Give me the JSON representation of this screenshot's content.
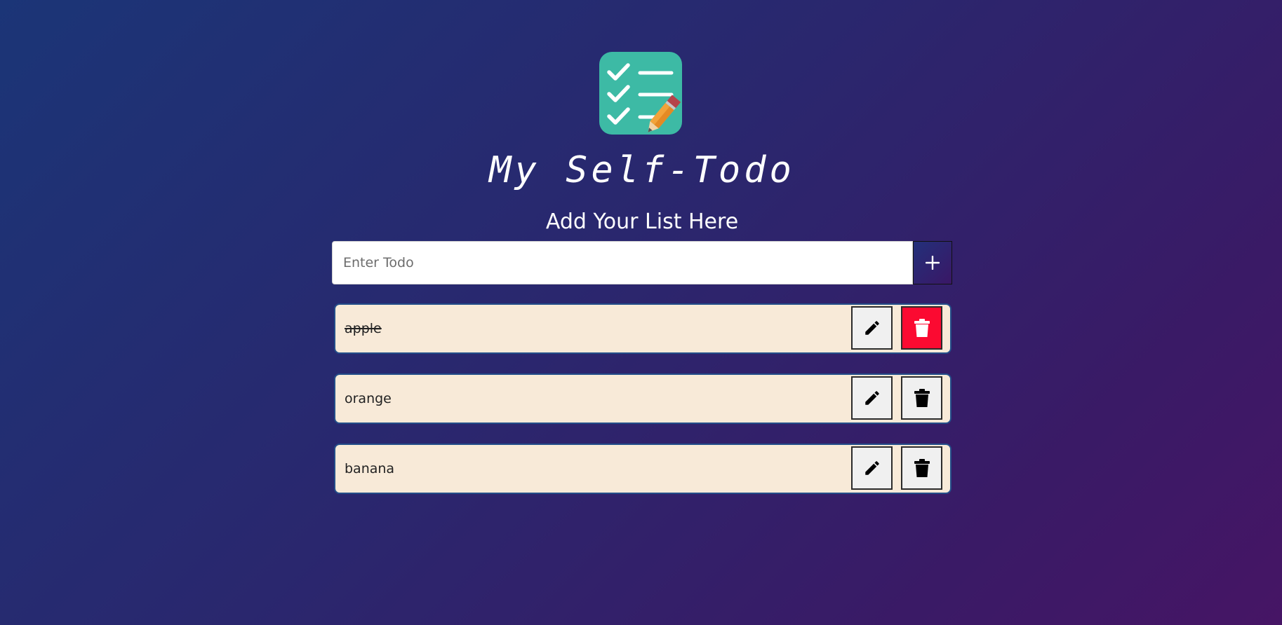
{
  "app": {
    "logo_icon": "checklist-pencil-icon",
    "title": "My Self-Todo",
    "subtitle": "Add Your List Here"
  },
  "input": {
    "placeholder": "Enter Todo",
    "value": "",
    "add_icon": "plus-icon"
  },
  "todos": [
    {
      "text": "apple",
      "completed": true,
      "edit_icon": "pencil-icon",
      "delete_icon": "trash-icon",
      "delete_highlighted": true
    },
    {
      "text": "orange",
      "completed": false,
      "edit_icon": "pencil-icon",
      "delete_icon": "trash-icon",
      "delete_highlighted": false
    },
    {
      "text": "banana",
      "completed": false,
      "edit_icon": "pencil-icon",
      "delete_icon": "trash-icon",
      "delete_highlighted": false
    }
  ],
  "colors": {
    "background_start": "#1b3577",
    "background_end": "#461565",
    "logo_teal": "#3dbaa5",
    "item_background": "#f8ead8",
    "delete_highlight": "#fb0a31"
  }
}
